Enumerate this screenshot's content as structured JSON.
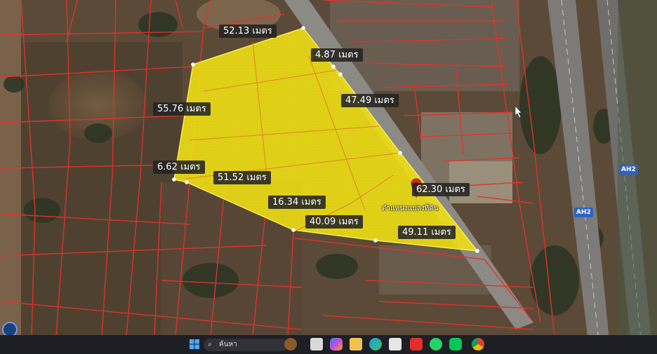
{
  "map": {
    "distance_labels": [
      "52.13 เมตร",
      "4.87 เมตร",
      "47.49 เมตร",
      "55.76 เมตร",
      "6.62 เมตร",
      "51.52 เมตร",
      "16.34 เมตร",
      "62.30 เมตร",
      "40.09 เมตร",
      "49.11 เมตร"
    ],
    "pin_caption": "ตำแหน่งแปลงที่ดิน",
    "highway_badges": [
      "AH2",
      "AH2"
    ],
    "colors": {
      "parcel_fill": "#f3e214",
      "parcel_lines": "#e5322a",
      "pin": "#e0252a",
      "highway_badge": "#2c63c4"
    }
  },
  "taskbar": {
    "search_placeholder": "ค้นหา",
    "apps": [
      "windows-start",
      "search",
      "widgets-dog",
      "file-explorer",
      "copilot",
      "folder",
      "edge",
      "store",
      "youtube",
      "whatsapp",
      "line",
      "chrome"
    ]
  }
}
